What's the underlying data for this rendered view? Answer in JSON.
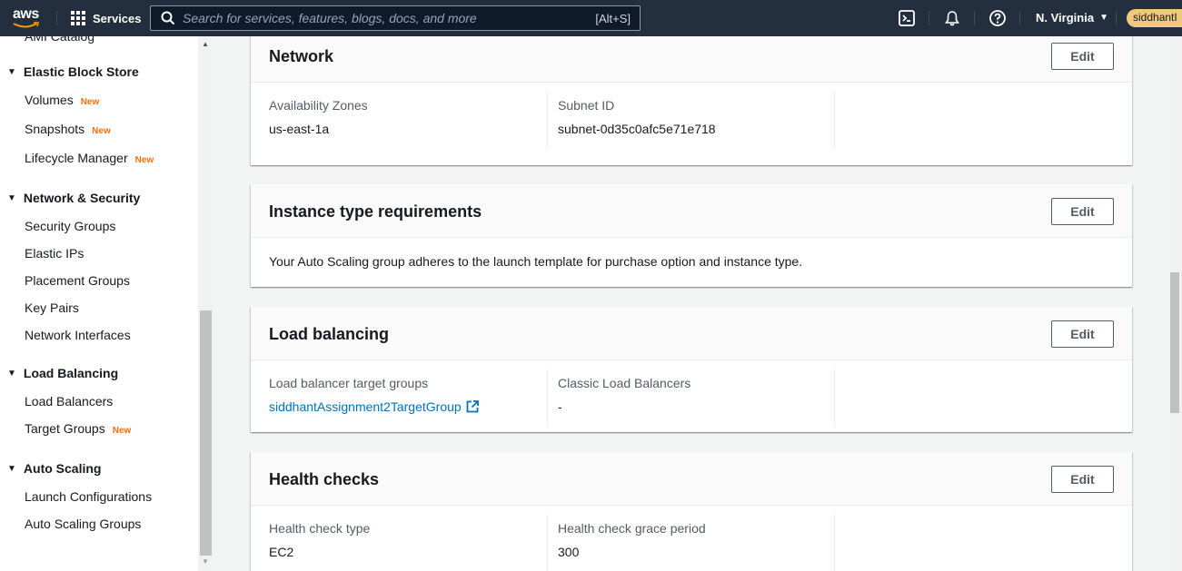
{
  "topnav": {
    "logo_text": "aws",
    "services_label": "Services",
    "search_placeholder": "Search for services, features, blogs, docs, and more",
    "search_shortcut": "[Alt+S]",
    "region": "N. Virginia",
    "account": "siddhantI"
  },
  "sidebar": {
    "cut_item": "AMI Catalog",
    "sections": [
      {
        "label": "Elastic Block Store",
        "items": [
          {
            "label": "Volumes",
            "badge": "New"
          },
          {
            "label": "Snapshots",
            "badge": "New"
          },
          {
            "label": "Lifecycle Manager",
            "badge": "New"
          }
        ]
      },
      {
        "label": "Network & Security",
        "items": [
          {
            "label": "Security Groups"
          },
          {
            "label": "Elastic IPs"
          },
          {
            "label": "Placement Groups"
          },
          {
            "label": "Key Pairs"
          },
          {
            "label": "Network Interfaces"
          }
        ]
      },
      {
        "label": "Load Balancing",
        "items": [
          {
            "label": "Load Balancers"
          },
          {
            "label": "Target Groups",
            "badge": "New"
          }
        ]
      },
      {
        "label": "Auto Scaling",
        "items": [
          {
            "label": "Launch Configurations"
          },
          {
            "label": "Auto Scaling Groups"
          }
        ]
      }
    ]
  },
  "cards": {
    "network": {
      "title": "Network",
      "edit": "Edit",
      "az_label": "Availability Zones",
      "az_value": "us-east-1a",
      "subnet_label": "Subnet ID",
      "subnet_value": "subnet-0d35c0afc5e71e718"
    },
    "instance": {
      "title": "Instance type requirements",
      "edit": "Edit",
      "text": "Your Auto Scaling group adheres to the launch template for purchase option and instance type."
    },
    "lb": {
      "title": "Load balancing",
      "edit": "Edit",
      "tg_label": "Load balancer target groups",
      "tg_value": "siddhantAssignment2TargetGroup",
      "clb_label": "Classic Load Balancers",
      "clb_value": "-"
    },
    "health": {
      "title": "Health checks",
      "edit": "Edit",
      "type_label": "Health check type",
      "type_value": "EC2",
      "grace_label": "Health check grace period",
      "grace_value": "300"
    }
  },
  "colors": {
    "nav_bg": "#232f3e",
    "link": "#0073bb",
    "new_badge": "#ec7211"
  }
}
